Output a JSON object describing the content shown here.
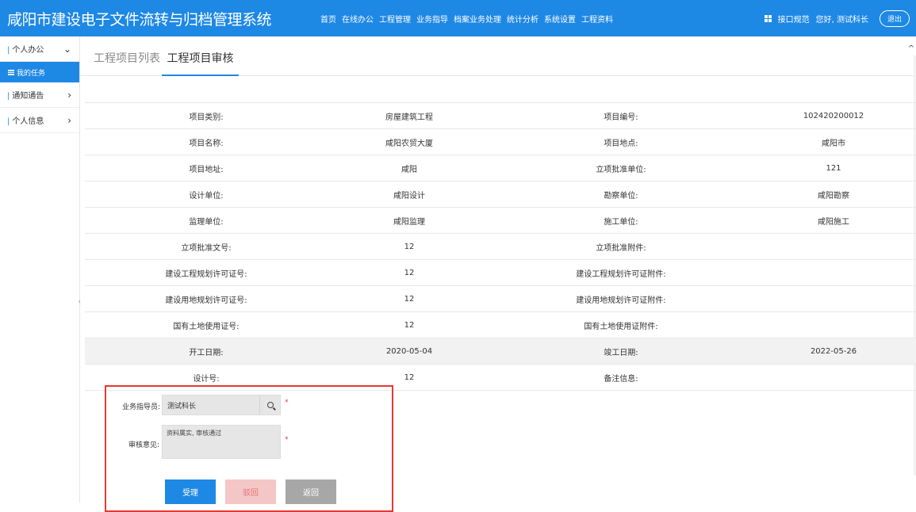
{
  "header": {
    "title": "咸阳市建设电子文件流转与归档管理系统",
    "nav": [
      "首页",
      "在线办公",
      "工程管理",
      "业务指导",
      "档案业务处理",
      "统计分析",
      "系统设置",
      "工程资料"
    ],
    "interface_spec": "接口规范",
    "greeting": "您好, 测试科长",
    "logout": "退出"
  },
  "sidebar": {
    "groups": [
      {
        "label": "个人办公",
        "chevron": "⌄"
      },
      {
        "label": "通知通告",
        "chevron": "›"
      },
      {
        "label": "个人信息",
        "chevron": "›"
      }
    ],
    "active_item": "我的任务"
  },
  "tabs": [
    "工程项目列表",
    "工程项目审核"
  ],
  "info_table": [
    [
      "项目类别:",
      "房屋建筑工程",
      "项目编号:",
      "102420200012"
    ],
    [
      "项目名称:",
      "咸阳农贸大厦",
      "项目地点:",
      "咸阳市"
    ],
    [
      "项目地址:",
      "咸阳",
      "立项批准单位:",
      "121"
    ],
    [
      "设计单位:",
      "咸阳设计",
      "勘察单位:",
      "咸阳勘察"
    ],
    [
      "监理单位:",
      "咸阳监理",
      "施工单位:",
      "咸阳施工"
    ],
    [
      "立项批准文号:",
      "12",
      "立项批准附件:",
      ""
    ],
    [
      "建设工程规划许可证号:",
      "12",
      "建设工程规划许可证附件:",
      ""
    ],
    [
      "建设用地规划许可证号:",
      "12",
      "建设用地规划许可证附件:",
      ""
    ],
    [
      "国有土地使用证号:",
      "12",
      "国有土地使用证附件:",
      ""
    ],
    [
      "开工日期:",
      "2020-05-04",
      "竣工日期:",
      "2022-05-26"
    ],
    [
      "设计号:",
      "12",
      "备注信息:",
      ""
    ]
  ],
  "form": {
    "guide_label": "业务指导员:",
    "guide_value": "测试科长",
    "opinion_label": "审核意见:",
    "opinion_value": "资料属实, 审核通过",
    "required_mark": "*",
    "accept": "受理",
    "reject": "驳回",
    "back": "返回"
  }
}
